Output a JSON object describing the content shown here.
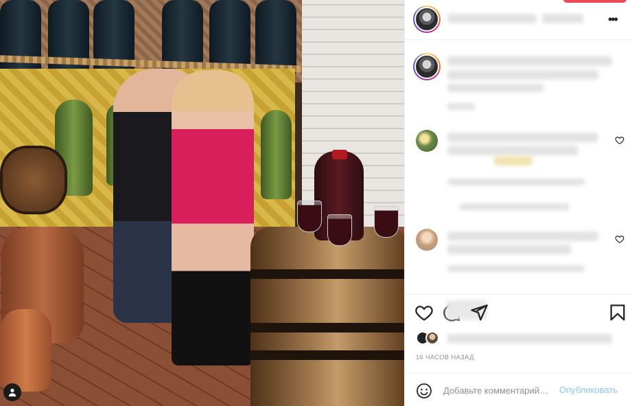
{
  "post": {
    "time_label": "16 ЧАСОВ НАЗАД"
  },
  "comment_box": {
    "placeholder": "Добавьте комментарий…",
    "post_label": "Опубликовать"
  },
  "colors": {
    "accent": "#0095f6",
    "post_disabled": "#8ec5f5",
    "notification": "#ed4956"
  },
  "icons": {
    "more": "more-icon",
    "like": "heart-icon",
    "comment": "comment-icon",
    "share": "share-icon",
    "save": "bookmark-icon",
    "emoji": "emoji-icon",
    "photo_owner": "user-icon"
  }
}
